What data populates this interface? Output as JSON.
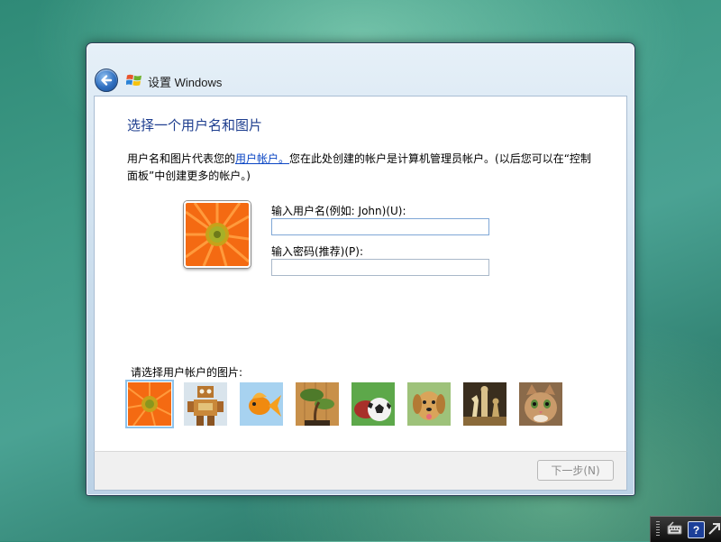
{
  "window": {
    "title": "设置 Windows"
  },
  "page": {
    "heading": "选择一个用户名和图片",
    "description_before_link": "用户名和图片代表您的",
    "description_link": "用户帐户。",
    "description_after_link": "您在此处创建的帐户是计算机管理员帐户。(以后您可以在“控制面板”中创建更多的帐户。)"
  },
  "form": {
    "username_label": "输入用户名(例如: John)(U):",
    "username_value": "",
    "password_label": "输入密码(推荐)(P):",
    "password_value": ""
  },
  "pictures": {
    "label": "请选择用户帐户的图片:",
    "selected_index": 0,
    "items": [
      "orange-flower",
      "robot",
      "goldfish",
      "bonsai",
      "soccer-ball",
      "dog",
      "chess",
      "kitten"
    ]
  },
  "footer": {
    "next_label": "下一步(N)",
    "next_enabled": false
  },
  "icons": {
    "back": "back-arrow-icon",
    "logo": "windows-logo-icon",
    "tray": [
      "separator-icon",
      "keyboard-icon",
      "help-icon",
      "arrow-icon"
    ]
  },
  "colors": {
    "heading": "#1e3e8f",
    "link": "#0b46c4",
    "titlebar": "#c9dcec"
  }
}
